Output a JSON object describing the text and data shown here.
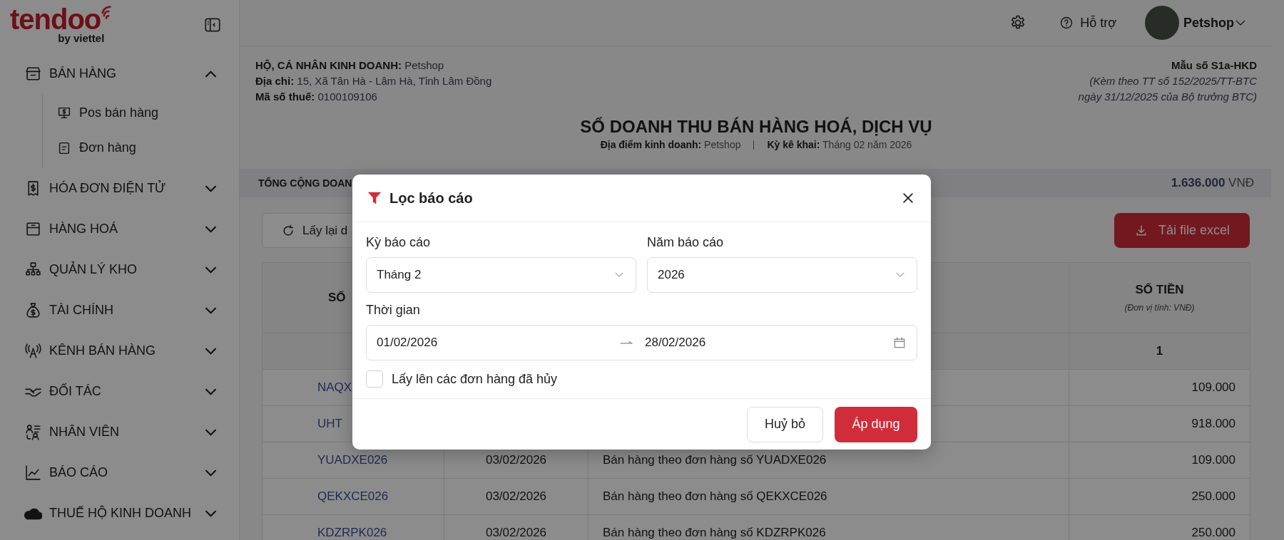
{
  "logo": {
    "name": "tendoo",
    "tagline": "by viettel"
  },
  "sidebar": {
    "items": [
      {
        "label": "BÁN HÀNG",
        "expanded": true,
        "children": [
          {
            "label": "Pos bán hàng"
          },
          {
            "label": "Đơn hàng"
          }
        ]
      },
      {
        "label": "HÓA ĐƠN ĐIỆN TỬ",
        "expanded": false
      },
      {
        "label": "HÀNG HOÁ",
        "expanded": false
      },
      {
        "label": "QUẢN LÝ KHO",
        "expanded": false
      },
      {
        "label": "TÀI CHÍNH",
        "expanded": false
      },
      {
        "label": "KÊNH BÁN HÀNG",
        "expanded": false
      },
      {
        "label": "ĐỐI TÁC",
        "expanded": false
      },
      {
        "label": "NHÂN VIÊN",
        "expanded": false
      },
      {
        "label": "BÁO CÁO",
        "expanded": false
      },
      {
        "label": "THUẾ HỘ KINH DOANH",
        "expanded": false
      }
    ]
  },
  "header": {
    "support": "Hỗ trợ",
    "user": "Petshop"
  },
  "report": {
    "fields": [
      {
        "label": "HỘ, CÁ NHÂN KINH DOANH:",
        "value": "Petshop"
      },
      {
        "label": "Địa chỉ:",
        "value": "15, Xã Tân Hà - Lâm Hà, Tỉnh Lâm Đồng"
      },
      {
        "label": "Mã số thuế:",
        "value": "0100109106"
      }
    ],
    "form_no": "Mẫu số S1a-HKD",
    "form_note": [
      "(Kèm theo TT số 152/2025/TT-BTC",
      "ngày 31/12/2025 của Bộ trưởng BTC)"
    ],
    "title": "SỔ DOANH THU BÁN HÀNG HOÁ, DỊCH VỤ",
    "meta": [
      {
        "label": "Địa điểm kinh doanh:",
        "value": "Petshop"
      },
      {
        "label": "Kỳ kê khai:",
        "value": "Tháng 02 năm 2026"
      }
    ],
    "total_label": "TỔNG CỘNG DOAN",
    "total_value": "1.636.000",
    "total_unit": "VNĐ"
  },
  "toolbar": {
    "refresh": "Lấy lại d",
    "export": "Tải file excel"
  },
  "table": {
    "code_column": {
      "title": "SỐ"
    },
    "amount_column": {
      "title": "SỐ TIỀN",
      "note": "(Đơn vị tính: VNĐ)",
      "index": "1"
    },
    "rows": [
      {
        "code": "NAQX",
        "amount": "109.000"
      },
      {
        "code": "UHT",
        "amount": "918.000"
      },
      {
        "code": "YUADXE026",
        "date": "03/02/2026",
        "description": "Bán hàng theo đơn hàng số YUADXE026",
        "amount": "109.000"
      },
      {
        "code": "QEKXCE026",
        "date": "03/02/2026",
        "description": "Bán hàng theo đơn hàng số QEKXCE026",
        "amount": "250.000"
      },
      {
        "code": "KDZRPK026",
        "date": "03/02/2026",
        "description": "Bán hàng theo đơn hàng số KDZRPK026",
        "amount": "250.000"
      }
    ]
  },
  "modal": {
    "title": "Lọc báo cáo",
    "period": {
      "label": "Kỳ báo cáo",
      "value": "Tháng 2"
    },
    "year": {
      "label": "Năm báo cáo",
      "value": "2026"
    },
    "time": {
      "label": "Thời gian",
      "from": "01/02/2026",
      "to": "28/02/2026"
    },
    "include_cancelled": {
      "label": "Lấy lên các đơn hàng đã hủy",
      "checked": false
    },
    "buttons": [
      {
        "label": "Huỷ bỏ",
        "kind": "secondary"
      },
      {
        "label": "Áp dụng",
        "kind": "primary"
      }
    ]
  }
}
